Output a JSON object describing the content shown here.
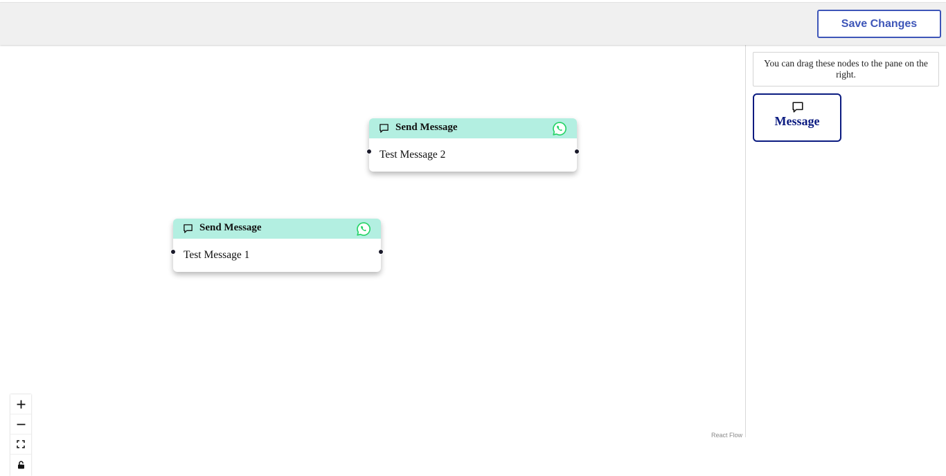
{
  "header": {
    "save_label": "Save Changes"
  },
  "panel": {
    "hint": "You can drag these nodes to the pane on the right.",
    "palette_node_label": "Message",
    "palette_node_icon": "message-icon"
  },
  "nodes": [
    {
      "title": "Send Message",
      "body": "Test Message 2",
      "icon": "message-icon",
      "channel_icon": "whatsapp-icon"
    },
    {
      "title": "Send Message",
      "body": "Test Message 1",
      "icon": "message-icon",
      "channel_icon": "whatsapp-icon"
    }
  ],
  "controls": {
    "zoom_in_icon": "plus-icon",
    "zoom_out_icon": "minus-icon",
    "fit_view_icon": "fit-view-icon",
    "lock_icon": "lock-icon"
  },
  "attribution": "React Flow",
  "colors": {
    "accent": "#3d55b8",
    "node_header": "#b3efe1",
    "palette_border": "#0a1a80",
    "whatsapp": "#25d366"
  }
}
